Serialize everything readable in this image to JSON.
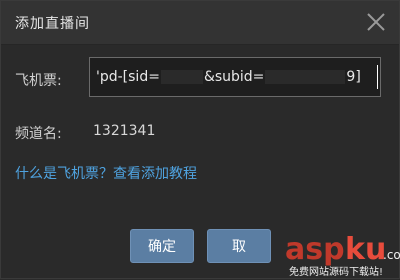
{
  "dialog": {
    "title": "添加直播间",
    "close_icon": "close-icon"
  },
  "form": {
    "ticket_label": "飞机票:",
    "ticket_value": "'pd-[sid=",
    "ticket_value_mid": "&subid=",
    "ticket_value_end": "9]",
    "channel_label": "频道名:",
    "channel_value": "1321341"
  },
  "help": {
    "link_text": "什么是飞机票？查看添加教程"
  },
  "buttons": {
    "confirm": "确定",
    "cancel": "取"
  },
  "watermark": {
    "brand": "aspku",
    "domain": ".com",
    "slogan": "免费网站源码下载站!"
  },
  "colors": {
    "accent": "#5b7ea3",
    "link": "#4fa3e0"
  }
}
